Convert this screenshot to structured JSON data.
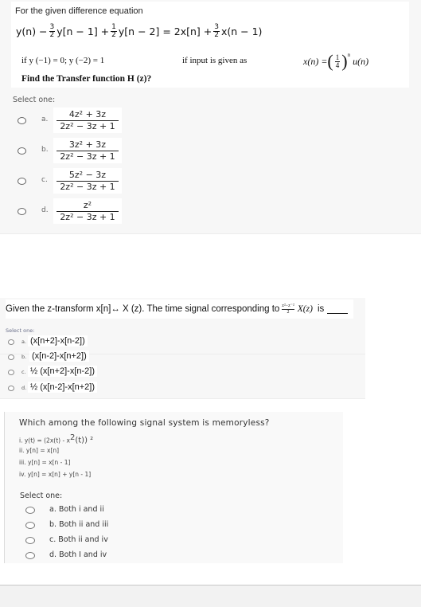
{
  "question1": {
    "title": "For the given difference equation",
    "equation": {
      "p1": "y(n) −",
      "f1_num": "3",
      "f1_den": "2",
      "p2": "y[n − 1] +",
      "f2_num": "1",
      "f2_den": "2",
      "p3": "y[n − 2] = 2x[n] +",
      "f3_num": "3",
      "f3_den": "2",
      "p4": "x(n − 1)"
    },
    "conditions": "if y (−1) = 0; y (−2) = 1",
    "input_label": "if input is given as",
    "input_expr": {
      "lhs": "x(n) =",
      "frac_num": "1",
      "frac_den": "4",
      "exp": "n",
      "rhs": "u(n)"
    },
    "prompt": "Find the Transfer function H (z)?",
    "select_label": "Select one:",
    "options": [
      {
        "letter": "a.",
        "numerator": "4z² + 3z",
        "denominator": "2z² − 3z + 1"
      },
      {
        "letter": "b.",
        "numerator": "3z² + 3z",
        "denominator": "2z² − 3z + 1"
      },
      {
        "letter": "c.",
        "numerator": "5z² − 3z",
        "denominator": "2z² − 3z + 1"
      },
      {
        "letter": "d.",
        "numerator": "z²",
        "denominator": "2z² − 3z + 1"
      }
    ]
  },
  "question2": {
    "text_before": "Given the z-transform  x[n]↔ X (z). The time signal corresponding to",
    "frac_num": "z²−z⁻²",
    "frac_den": "2",
    "xz": "X(z)",
    "text_after": "is",
    "select_label": "Select one:",
    "options": [
      {
        "letter": "a.",
        "text": "(x[n+2]-x[n-2])"
      },
      {
        "letter": "b.",
        "text": "(x[n-2]-x[n+2])"
      },
      {
        "letter": "c.",
        "text": "½ (x[n+2]-x[n-2])"
      },
      {
        "letter": "d.",
        "text": "½ (x[n-2]-x[n+2])"
      }
    ]
  },
  "question3": {
    "title": "Which among the following signal system is memoryless?",
    "items": [
      {
        "prefix": "i. y(t) = (2x(t) - x",
        "sup": "2",
        "suffix": "(t)) ²"
      },
      {
        "text": "ii. y[n] = x[n]"
      },
      {
        "text": "iii. y[n] = x[n - 1]"
      },
      {
        "text": "iv. y[n] = x[n] + y[n - 1]"
      }
    ],
    "select_label": "Select one:",
    "options": [
      {
        "text": "a. Both i and ii"
      },
      {
        "text": "b. Both ii and iii"
      },
      {
        "text": "c. Both ii and iv"
      },
      {
        "text": "d. Both I and iv"
      }
    ]
  }
}
